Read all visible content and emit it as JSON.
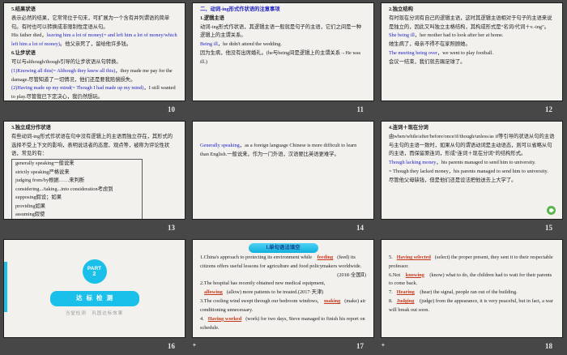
{
  "colors": {
    "background": "#474747",
    "slide_bg": "#f2f1ed",
    "text": "#1c1c1c",
    "blue": "#2222c4",
    "red": "#c43a1e",
    "cyan": "#1bc0ea",
    "badge_text": "#17418e",
    "green": "#58b44b",
    "number": "#e8e8e8",
    "muted": "#9a9a9a",
    "box_border": "#5a5a5a"
  },
  "icons": {
    "transition_star": "✦"
  },
  "slides": [
    {
      "number": "10",
      "type": "text",
      "paragraphs": [
        {
          "bold": true,
          "segments": [
            {
              "t": "5.结果状语",
              "c": "k"
            }
          ]
        },
        {
          "segments": [
            {
              "t": "表示必然的结果，它常常位于句末，可扩展为一个含有并列谓语的简单句。有时也可以转换成非限制性定语从句。",
              "c": "k"
            }
          ]
        },
        {
          "segments": [
            {
              "t": "His father died，",
              "c": "k"
            },
            {
              "t": "leaving him a lot of money(= and left him a lot of money/which left him a lot of money)",
              "c": "b"
            },
            {
              "t": "。他父亲死了，留给他许多钱。",
              "c": "k"
            }
          ]
        },
        {
          "bold": true,
          "segments": [
            {
              "t": "6.让步状语",
              "c": "k"
            }
          ]
        },
        {
          "segments": [
            {
              "t": "可以与although/though引导的让步状语从句转换。",
              "c": "k"
            }
          ]
        },
        {
          "segments": [
            {
              "t": "(1)Knowing all this(= Although they knew all this)",
              "c": "b"
            },
            {
              "t": "，they made me pay for the damage.尽管知道了一切情况，他们还是要我赔偿损失。",
              "c": "k"
            }
          ]
        },
        {
          "segments": [
            {
              "t": "(2)Having made up my mind(= Though I had made up my mind)",
              "c": "b"
            },
            {
              "t": "，I still wanted to play.尽管我已下定决心，我仍然想玩。",
              "c": "k"
            }
          ]
        }
      ]
    },
    {
      "number": "11",
      "type": "text",
      "paragraphs": [
        {
          "bold": true,
          "segments": [
            {
              "t": "二、动词-ing形式作状语的注意事项",
              "c": "b"
            }
          ]
        },
        {
          "bold": true,
          "segments": [
            {
              "t": "1.逻辑主语",
              "c": "k"
            }
          ]
        },
        {
          "segments": [
            {
              "t": "动词-ing形式作状语，其逻辑主语一般就是句子的主语，它们之间是一种逻辑上的主谓关系。",
              "c": "k"
            }
          ]
        },
        {
          "segments": [
            {
              "t": "Being ill",
              "c": "b"
            },
            {
              "t": "，he didn't attend the wedding.",
              "c": "k"
            }
          ]
        },
        {
          "segments": [
            {
              "t": "因为生病，他没有出席婚礼。(he与being间是逻辑上的主谓关系→He was ill.)",
              "c": "k"
            }
          ]
        }
      ]
    },
    {
      "number": "12",
      "type": "text",
      "paragraphs": [
        {
          "bold": true,
          "segments": [
            {
              "t": "2.独立结构",
              "c": "k"
            }
          ]
        },
        {
          "segments": [
            {
              "t": "有时现在分词有自己的逻辑主语，这时其逻辑主语相对于句子的主语来说是独立的，因此又叫独立主格结构，其构成形式是“名词/代词＋v.-ing”。",
              "c": "k"
            }
          ]
        },
        {
          "segments": [
            {
              "t": "She being ill",
              "c": "b"
            },
            {
              "t": "，her mother had to look after her at home.",
              "c": "k"
            }
          ]
        },
        {
          "segments": [
            {
              "t": "她生病了，母亲不得不在家照顾她。",
              "c": "k"
            }
          ]
        },
        {
          "segments": [
            {
              "t": "The meeting being over",
              "c": "b"
            },
            {
              "t": "，we went to play football.",
              "c": "k"
            }
          ]
        },
        {
          "segments": [
            {
              "t": "会议一结束，我们就去踢足球了。",
              "c": "k"
            }
          ]
        }
      ]
    },
    {
      "number": "13",
      "type": "text",
      "paragraphs": [
        {
          "bold": true,
          "segments": [
            {
              "t": "3.独立成分作状语",
              "c": "k"
            }
          ]
        },
        {
          "segments": [
            {
              "t": "有些动词-ing形式作状语在句中没有逻辑上的主语而独立存在，其形式的选择不受上下文的影响，表明说话者的态度、观点等，被称为评论性状语，常见的有：",
              "c": "k"
            }
          ]
        }
      ],
      "box": {
        "items": [
          "generally speaking一般说来",
          "strictly speaking严格说来",
          "judging from/by根据……来判断",
          "considering.../taking...into consideration考虑到",
          "supposing假设；如果",
          "providing如果",
          "assuming假使"
        ]
      }
    },
    {
      "number": "14",
      "type": "text",
      "paragraphs": [
        {
          "mt": 22,
          "segments": [
            {
              "t": "Generally speaking",
              "c": "b"
            },
            {
              "t": "，as a foreign language Chinese is more difficult to learn than English.一般说来，作为一门外语，汉语要比英语更难学。",
              "c": "k"
            }
          ]
        }
      ]
    },
    {
      "number": "15",
      "type": "text",
      "return_icon": true,
      "paragraphs": [
        {
          "bold": true,
          "segments": [
            {
              "t": "4.连词＋现在分词",
              "c": "k"
            }
          ]
        },
        {
          "segments": [
            {
              "t": "由when/while/after/before/once/if/though/unless/as if等引导的状语从句的主语与主句的主语一致时，如果从句的谓语动词是主动语态，则可以省略从句的主语，而保留原连词，形成“连词＋现在分词”的结构形式。",
              "c": "k"
            }
          ]
        },
        {
          "segments": [
            {
              "t": "Though lacking money",
              "c": "b"
            },
            {
              "t": "，his parents managed to send him to university.",
              "c": "k"
            }
          ]
        },
        {
          "segments": [
            {
              "t": "= Though they lacked money，his parents managed to send him to university.",
              "c": "k"
            }
          ]
        },
        {
          "segments": [
            {
              "t": "尽管他父母缺钱，但是他们还是设法把他送去上大学了。",
              "c": "k"
            }
          ]
        }
      ]
    },
    {
      "number": "16",
      "type": "divider",
      "divider": {
        "part_label": "PART",
        "part_number": "2",
        "button": "达标检测",
        "subtitle": "当堂检测　巩固达标效果"
      }
    },
    {
      "number": "17",
      "type": "text",
      "star": true,
      "badge": "Ⅰ.单句语法填空",
      "paragraphs": [
        {
          "segments": [
            {
              "t": "1.China's approach to protecting its environment while ",
              "c": "k"
            },
            {
              "t": "feeding",
              "c": "r"
            },
            {
              "t": "(feed) its citizens offers useful lessons for agriculture and food policymakers worldwide.",
              "c": "k"
            }
          ]
        },
        {
          "align": "right",
          "segments": [
            {
              "t": "(2018·全国Ⅱ)",
              "c": "k"
            }
          ]
        },
        {
          "segments": [
            {
              "t": "2.The hospital has recently obtained new medical equipment, ",
              "c": "k"
            },
            {
              "t": "allowing",
              "c": "r"
            },
            {
              "t": "(allow) more patients to be treated.(2017·天津)",
              "c": "k"
            }
          ]
        },
        {
          "segments": [
            {
              "t": "3.The cooling wind swept through our bedroom windows, ",
              "c": "k"
            },
            {
              "t": "making",
              "c": "r"
            },
            {
              "t": "(make) air conditioning unnecessary.",
              "c": "k"
            }
          ]
        },
        {
          "segments": [
            {
              "t": "4.",
              "c": "k"
            },
            {
              "t": "Having worked",
              "c": "r"
            },
            {
              "t": "(work) for two days, Steve managed to finish his report on schedule.",
              "c": "k"
            }
          ]
        }
      ]
    },
    {
      "number": "18",
      "type": "text",
      "star": true,
      "paragraphs": [
        {
          "mt": 14,
          "segments": [
            {
              "t": "5.",
              "c": "k"
            },
            {
              "t": "Having selected",
              "c": "r"
            },
            {
              "t": "(select) the proper present, they sent it to their respectable professor.",
              "c": "k"
            }
          ]
        },
        {
          "segments": [
            {
              "t": "6.Not ",
              "c": "k"
            },
            {
              "t": "knowing",
              "c": "r"
            },
            {
              "t": " (know) what to do, the children had to wait for their parents to come back.",
              "c": "k"
            }
          ]
        },
        {
          "segments": [
            {
              "t": "7.",
              "c": "k"
            },
            {
              "t": "Hearing",
              "c": "r"
            },
            {
              "t": " (hear) the signal, people ran out of the building.",
              "c": "k"
            }
          ]
        },
        {
          "segments": [
            {
              "t": "8.",
              "c": "k"
            },
            {
              "t": "Judging",
              "c": "r"
            },
            {
              "t": " (judge) from the appearance, it is very peaceful, but in fact, a war will break out soon.",
              "c": "k"
            }
          ]
        }
      ]
    }
  ]
}
